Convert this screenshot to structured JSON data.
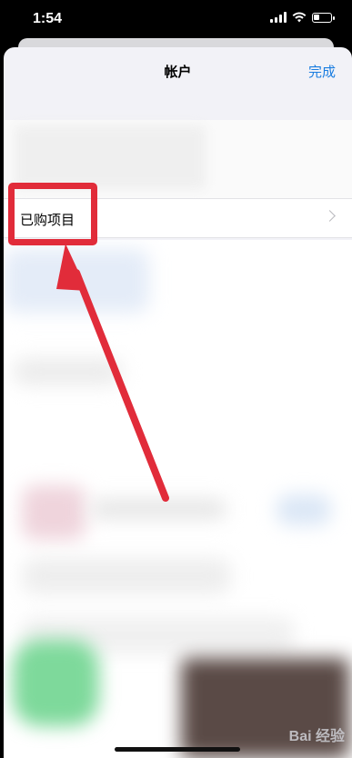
{
  "status_bar": {
    "time": "1:54"
  },
  "nav": {
    "title": "帐户",
    "done_label": "完成"
  },
  "rows": {
    "purchased_label": "已购项目"
  },
  "watermark": {
    "text": "Bai 经验"
  },
  "colors": {
    "accent": "#1a7de0",
    "annotation": "#e12c3a",
    "sheet_bg": "#f2f2f7"
  }
}
